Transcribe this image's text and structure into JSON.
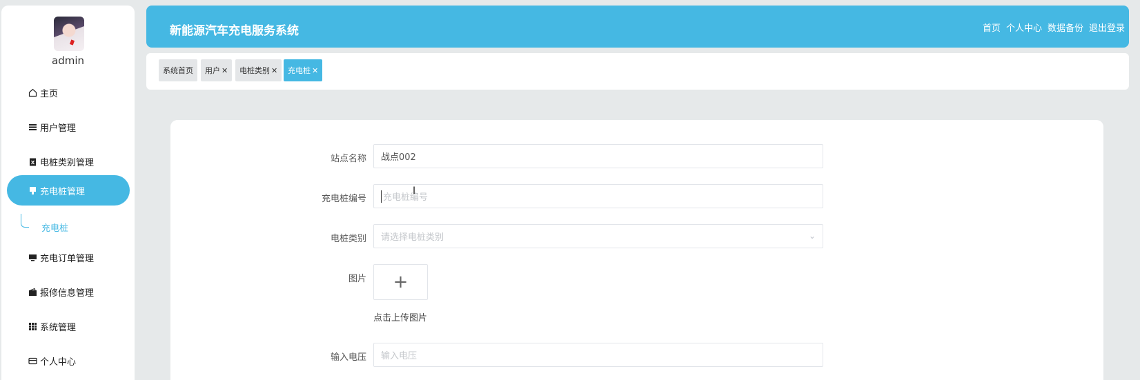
{
  "user": {
    "name": "admin"
  },
  "sidebar": {
    "items": [
      {
        "label": "主页",
        "icon": "home-icon"
      },
      {
        "label": "用户管理",
        "icon": "list-icon"
      },
      {
        "label": "电桩类别管理",
        "icon": "clipboard-icon"
      },
      {
        "label": "充电桩管理",
        "icon": "plug-icon",
        "active": true
      },
      {
        "label": "充电订单管理",
        "icon": "monitor-icon"
      },
      {
        "label": "报修信息管理",
        "icon": "wallet-icon"
      },
      {
        "label": "系统管理",
        "icon": "grid-icon"
      },
      {
        "label": "个人中心",
        "icon": "card-icon"
      }
    ],
    "submenu": {
      "label": "充电桩"
    }
  },
  "header": {
    "title": "新能源汽车充电服务系统",
    "links": [
      "首页",
      "个人中心",
      "数据备份",
      "退出登录"
    ]
  },
  "tabs": [
    {
      "label": "系统首页",
      "closable": false
    },
    {
      "label": "用户",
      "closable": true
    },
    {
      "label": "电桩类别",
      "closable": true
    },
    {
      "label": "充电桩",
      "closable": true,
      "active": true
    }
  ],
  "form": {
    "station_name": {
      "label": "站点名称",
      "value": "战点002"
    },
    "pile_no": {
      "label": "充电桩编号",
      "placeholder": "充电桩编号"
    },
    "pile_type": {
      "label": "电桩类别",
      "placeholder": "请选择电桩类别"
    },
    "image": {
      "label": "图片",
      "upload_hint": "点击上传图片",
      "plus": "+"
    },
    "voltage": {
      "label": "输入电压",
      "placeholder": "输入电压"
    }
  },
  "colors": {
    "accent": "#45b8e3",
    "background": "#e6e9ea"
  }
}
